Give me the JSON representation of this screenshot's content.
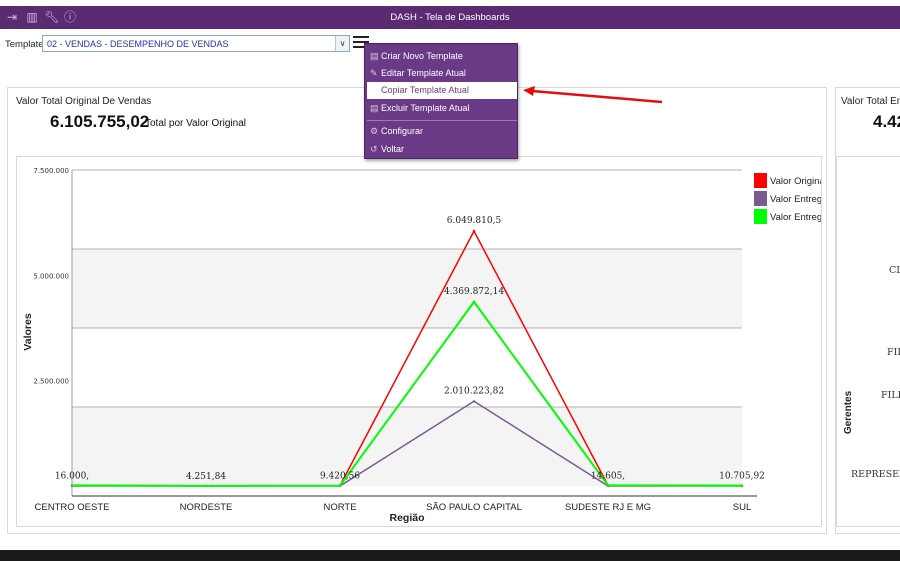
{
  "window": {
    "title": "DASH - Tela de Dashboards",
    "icons": [
      "exit-icon",
      "grid-icon",
      "wrench-icon",
      "info-icon"
    ]
  },
  "toolbar": {
    "template_label": "Template",
    "template_value": "02 - VENDAS - DESEMPENHO DE VENDAS"
  },
  "menu": {
    "items": [
      {
        "label": "Criar Novo Template",
        "icon": "new-template-icon"
      },
      {
        "label": "Editar Template Atual",
        "icon": "edit-icon"
      },
      {
        "label": "Copiar Template Atual",
        "icon": "copy-icon"
      },
      {
        "label": "Excluir Template Atual",
        "icon": "delete-icon"
      },
      {
        "label": "Configurar",
        "icon": "configure-icon"
      },
      {
        "label": "Voltar",
        "icon": "back-icon"
      }
    ]
  },
  "panel_left": {
    "label": "Valor Total Original De Vendas",
    "value": "6.105.755,02",
    "value_suffix": "Total por Valor Original"
  },
  "panel_right": {
    "label": "Valor Total Ent",
    "value": "4.42",
    "y_label": "Gerentes",
    "categories": [
      "CL",
      "FILI",
      "FILIA",
      "REPRESENTA"
    ]
  },
  "chart_data": {
    "type": "line",
    "xlabel": "Região",
    "ylabel": "Valores",
    "ylim": [
      0,
      7500000
    ],
    "y_ticks": [
      {
        "value": 7500000,
        "label": "7.500.000"
      },
      {
        "value": 5000000,
        "label": "5.000.000"
      },
      {
        "value": 2500000,
        "label": "2.500.000"
      }
    ],
    "grid": true,
    "legend_position": "top-right",
    "categories": [
      "CENTRO OESTE",
      "NORDESTE",
      "NORTE",
      "SÃO PAULO CAPITAL",
      "SUDESTE RJ E MG",
      "SUL"
    ],
    "series": [
      {
        "name": "Valor Original",
        "color": "#ff0000",
        "values": [
          16000,
          4251.84,
          9420.56,
          6049810.5,
          14605,
          10705.92
        ]
      },
      {
        "name": "Valor Entregar",
        "color": "#7a5a8f",
        "values": [
          0,
          0,
          0,
          2010223.82,
          0,
          0
        ]
      },
      {
        "name": "Valor Entregue",
        "color": "#00ff00",
        "values": [
          16000,
          4251.84,
          9420.56,
          4369872.14,
          14605,
          10705.92
        ]
      }
    ],
    "data_labels": [
      {
        "cat": 0,
        "y": 16000,
        "text": "16.000,"
      },
      {
        "cat": 1,
        "y": 4251.84,
        "text": "4.251,84"
      },
      {
        "cat": 2,
        "y": 9420.56,
        "text": "9.420,56"
      },
      {
        "cat": 3,
        "y": 6049810.5,
        "text": "6.049.810,5"
      },
      {
        "cat": 3,
        "y": 4369872.14,
        "text": "4.369.872,14"
      },
      {
        "cat": 3,
        "y": 2010223.82,
        "text": "2.010.223,82"
      },
      {
        "cat": 4,
        "y": 14605,
        "text": "14.605,"
      },
      {
        "cat": 5,
        "y": 10705.92,
        "text": "10.705,92"
      }
    ]
  }
}
